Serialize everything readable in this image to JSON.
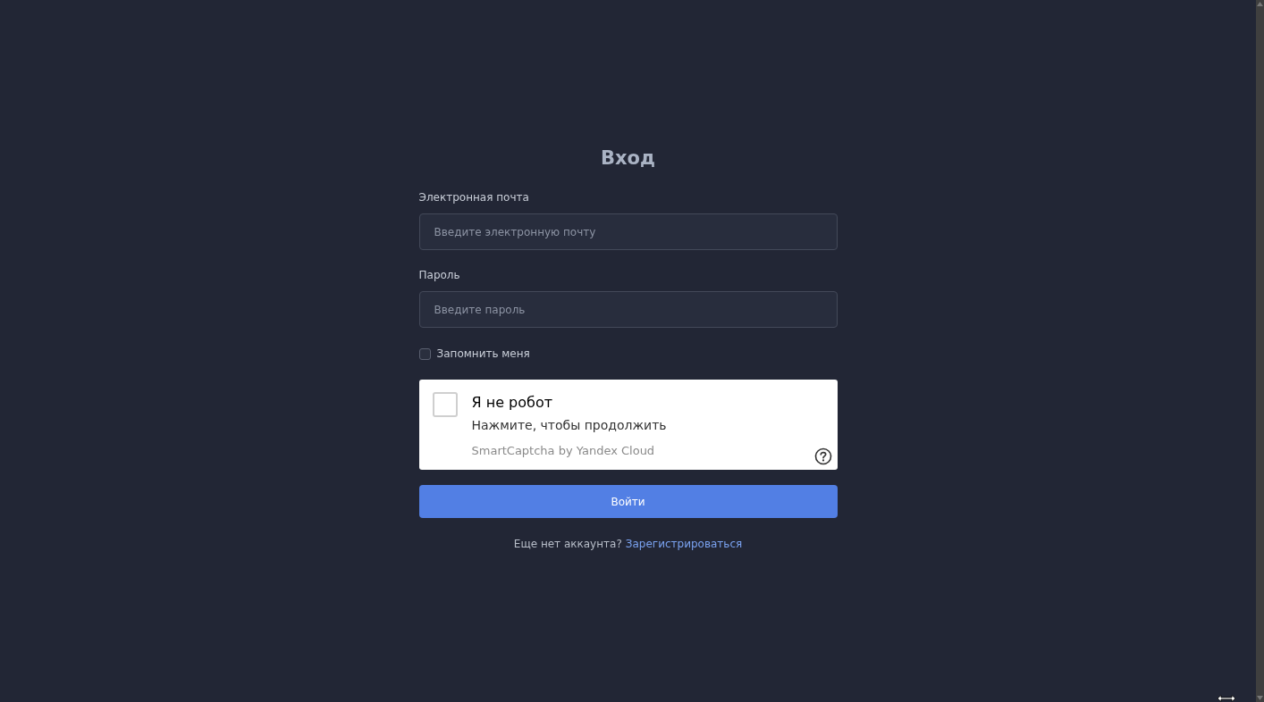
{
  "title": "Вход",
  "fields": [
    {
      "label": "Электронная почта",
      "placeholder": "Введите электронную почту"
    },
    {
      "label": "Пароль",
      "placeholder": "Введите пароль"
    }
  ],
  "remember": {
    "label": "Запомнить меня",
    "checked": false
  },
  "captcha": {
    "title": "Я не робот",
    "subtitle": "Нажмите, чтобы продолжить",
    "brand": "SmartCaptcha by Yandex Cloud",
    "checked": false
  },
  "submit": "Войти",
  "footer": {
    "text": "Еще нет аккаунта?",
    "link": "Зарегистрироваться"
  }
}
